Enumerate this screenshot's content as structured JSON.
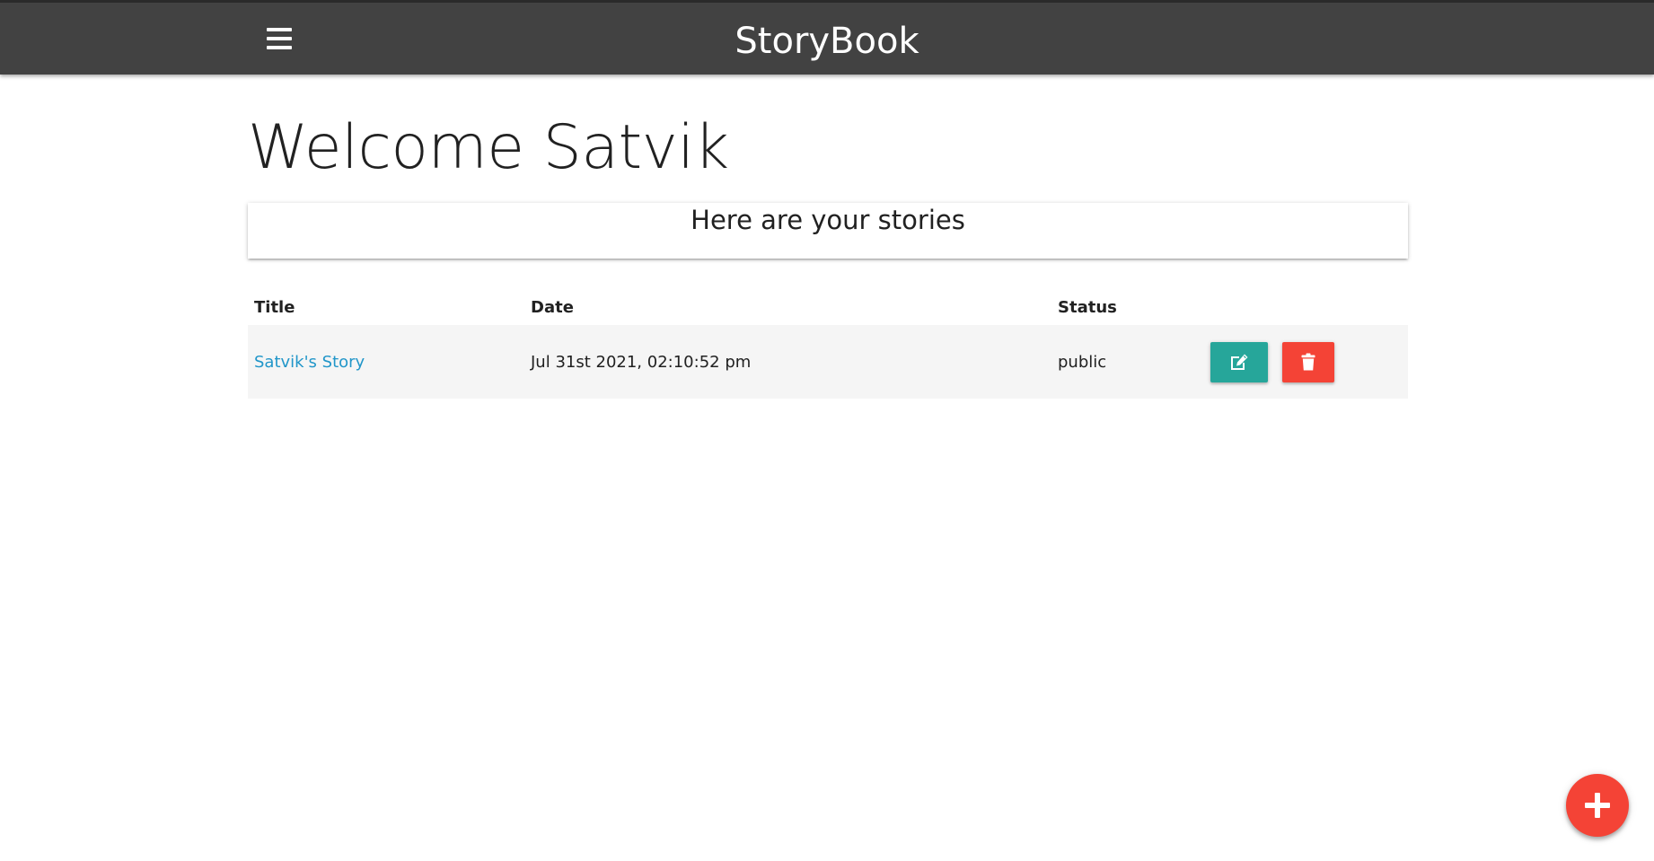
{
  "navbar": {
    "brand": "StoryBook",
    "menu_icon": "hamburger-menu-icon"
  },
  "dashboard": {
    "welcome": "Welcome Satvik",
    "card_title": "Here are your stories"
  },
  "table": {
    "headers": {
      "title": "Title",
      "date": "Date",
      "status": "Status"
    },
    "rows": [
      {
        "title": "Satvik's Story",
        "date": "Jul 31st 2021, 02:10:52 pm",
        "status": "public",
        "edit_icon": "edit-icon",
        "delete_icon": "trash-icon"
      }
    ]
  },
  "fab": {
    "icon": "plus-icon"
  },
  "colors": {
    "navbar": "#424242",
    "edit_button": "#26a69a",
    "delete_button": "#f44336",
    "fab": "#f44336",
    "link": "#2196c9",
    "row_background": "#f5f5f5"
  }
}
